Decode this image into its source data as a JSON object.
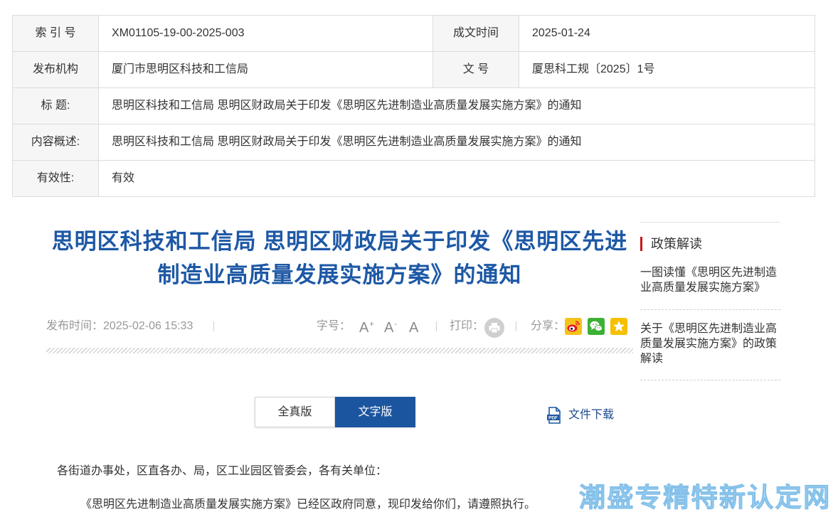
{
  "info_table": {
    "rows": [
      {
        "label": "索 引 号",
        "value": "XM01105-19-00-2025-003",
        "label2": "成文时间",
        "value2": "2025-01-24"
      },
      {
        "label": "发布机构",
        "value": "厦门市思明区科技和工信局",
        "label2": "文 号",
        "value2": "厦思科工规〔2025〕1号"
      },
      {
        "label": "标 题:",
        "value": "思明区科技和工信局 思明区财政局关于印发《思明区先进制造业高质量发展实施方案》的通知"
      },
      {
        "label": "内容概述:",
        "value": "思明区科技和工信局 思明区财政局关于印发《思明区先进制造业高质量发展实施方案》的通知"
      },
      {
        "label": "有效性:",
        "value": "有效"
      }
    ]
  },
  "article": {
    "title": "思明区科技和工信局 思明区财政局关于印发《思明区先进制造业高质量发展实施方案》的通知",
    "meta": {
      "publish_label": "发布时间：",
      "publish_time": "2025-02-06 15:33",
      "font_size_label": "字号：",
      "font_size_options": [
        {
          "letter": "A",
          "modifier": "+"
        },
        {
          "letter": "A",
          "modifier": "-"
        },
        {
          "letter": "A",
          "modifier": ""
        }
      ],
      "print_label": "打印：",
      "print_icon": "printer-icon",
      "share_label": "分享：",
      "share_icons": [
        "weibo-icon",
        "wechat-icon",
        "qzone-star-icon"
      ]
    },
    "view_tabs": [
      {
        "label": "全真版",
        "active": false
      },
      {
        "label": "文字版",
        "active": true
      }
    ],
    "download": {
      "label": "文件下载",
      "icon": "pdf-icon",
      "icon_text": "PDF"
    },
    "body_paragraphs": [
      "各街道办事处，区直各办、局，区工业园区管委会，各有关单位：",
      "《思明区先进制造业高质量发展实施方案》已经区政府同意，现印发给你们，请遵照执行。"
    ]
  },
  "sidebar": {
    "heading": "政策解读",
    "links": [
      "一图读懂《思明区先进制造业高质量发展实施方案》",
      "关于《思明区先进制造业高质量发展实施方案》的政策解读"
    ]
  },
  "watermark": {
    "text": "潮盛专精特新认定网"
  },
  "colors": {
    "title_blue": "#1d58a5",
    "active_tab": "#1c559f",
    "accent_red": "#c8161d",
    "meta_gray": "#999999",
    "link_navy": "#1f4a8c",
    "watermark_blue": "#9fd3f3"
  }
}
